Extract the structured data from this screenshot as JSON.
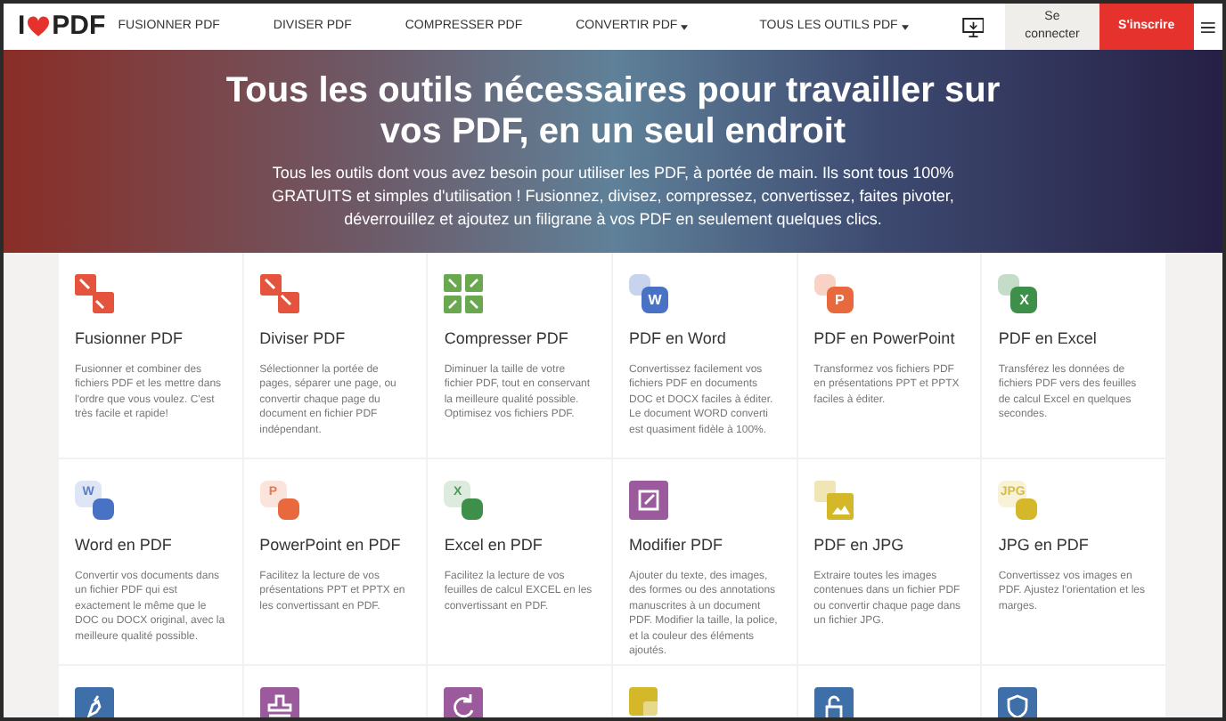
{
  "logo": {
    "left": "I",
    "right": "PDF"
  },
  "nav": [
    {
      "label": "FUSIONNER PDF",
      "dropdown": false
    },
    {
      "label": "DIVISER PDF",
      "dropdown": false
    },
    {
      "label": "COMPRESSER PDF",
      "dropdown": false
    },
    {
      "label": "CONVERTIR PDF",
      "dropdown": true
    },
    {
      "label": "TOUS LES OUTILS PDF",
      "dropdown": true
    }
  ],
  "login": "Se connecter",
  "signup": "S'inscrire",
  "hero": {
    "title": "Tous les outils nécessaires pour travailler sur vos PDF, en un seul endroit",
    "subtitle": "Tous les outils dont vous avez besoin pour utiliser les PDF, à portée de main. Ils sont tous 100% GRATUITS et simples d'utilisation ! Fusionnez, divisez, compressez, convertissez, faites pivoter, déverrouillez et ajoutez un filigrane à vos PDF en seulement quelques clics."
  },
  "tools": [
    {
      "kind": "merge",
      "color": "#e5533d",
      "title": "Fusionner PDF",
      "description": "Fusionner et combiner des fichiers PDF et les mettre dans l'ordre que vous voulez. C'est très facile et rapide!"
    },
    {
      "kind": "split",
      "color": "#e5533d",
      "title": "Diviser PDF",
      "description": "Sélectionner la portée de pages, séparer une page, ou convertir chaque page du document en fichier PDF indépendant."
    },
    {
      "kind": "compress",
      "color": "#6aa84f",
      "title": "Compresser PDF",
      "description": "Diminuer la taille de votre fichier PDF, tout en conservant la meilleure qualité possible. Optimisez vos fichiers PDF."
    },
    {
      "kind": "to-letter",
      "color": "#4a72c4",
      "letter": "W",
      "title": "PDF en Word",
      "description": "Convertissez facilement vos fichiers PDF en documents DOC et DOCX faciles à éditer. Le document WORD converti est quasiment fidèle à 100%."
    },
    {
      "kind": "to-letter",
      "color": "#e8693d",
      "letter": "P",
      "title": "PDF en PowerPoint",
      "description": "Transformez vos fichiers PDF en présentations PPT et PPTX faciles à éditer."
    },
    {
      "kind": "to-letter",
      "color": "#3e8f4a",
      "letter": "X",
      "title": "PDF en Excel",
      "description": "Transférez les données de fichiers PDF vers des feuilles de calcul Excel en quelques secondes."
    },
    {
      "kind": "from-letter",
      "color": "#4a72c4",
      "letter": "W",
      "title": "Word en PDF",
      "description": "Convertir vos documents dans un fichier PDF qui est exactement le même que le DOC ou DOCX original, avec la meilleure qualité possible."
    },
    {
      "kind": "from-letter",
      "color": "#e8693d",
      "letter": "P",
      "title": "PowerPoint en PDF",
      "description": "Facilitez la lecture de vos présentations PPT et PPTX en les convertissant en PDF."
    },
    {
      "kind": "from-letter",
      "color": "#3e8f4a",
      "letter": "X",
      "title": "Excel en PDF",
      "description": "Facilitez la lecture de vos feuilles de calcul EXCEL en les convertissant en PDF."
    },
    {
      "kind": "edit",
      "color": "#9b5a9b",
      "title": "Modifier PDF",
      "description": "Ajouter du texte, des images, des formes ou des annotations manuscrites à un document PDF. Modifier la taille, la police, et la couleur des éléments ajoutés."
    },
    {
      "kind": "to-image",
      "color": "#d4b82a",
      "title": "PDF en JPG",
      "description": "Extraire toutes les images contenues dans un fichier PDF ou convertir chaque page dans un fichier JPG."
    },
    {
      "kind": "from-letter",
      "color": "#d4b82a",
      "letter": "JPG",
      "title": "JPG en PDF",
      "description": "Convertissez vos images en PDF. Ajustez l'orientation et les marges."
    },
    {
      "kind": "pen",
      "color": "#3f6fa8"
    },
    {
      "kind": "stamp",
      "color": "#9b5a9b"
    },
    {
      "kind": "rotate",
      "color": "#9b5a9b"
    },
    {
      "kind": "web",
      "color": "#d4b82a"
    },
    {
      "kind": "lock",
      "color": "#3f6fa8"
    },
    {
      "kind": "shield",
      "color": "#3f6fa8"
    }
  ]
}
